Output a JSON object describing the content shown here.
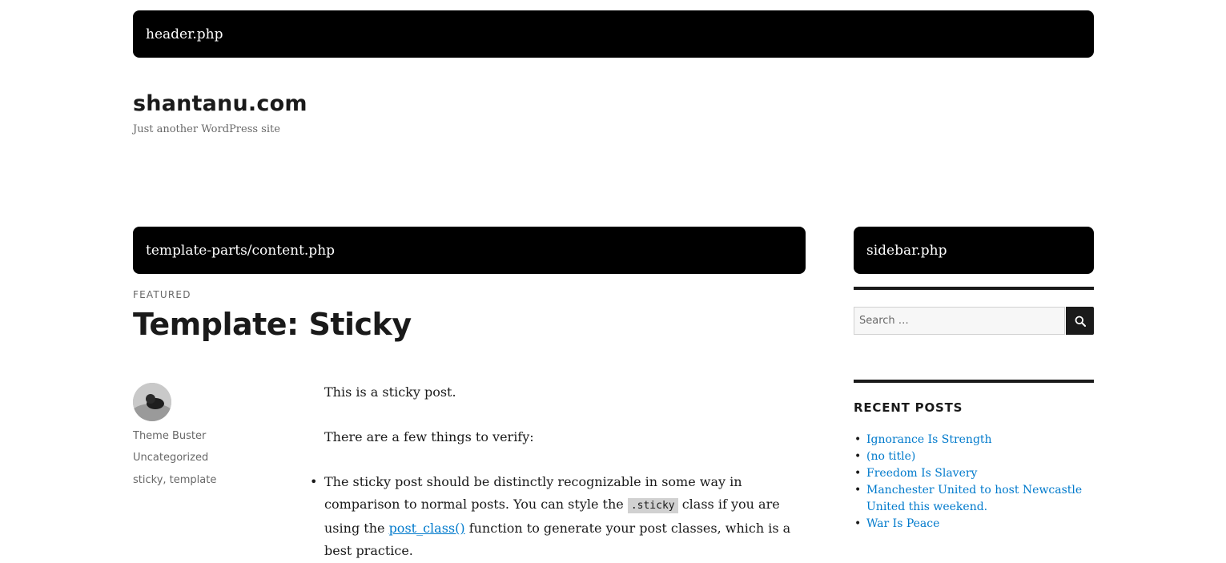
{
  "labels": {
    "header": "header.php",
    "content": "template-parts/content.php",
    "sidebar": "sidebar.php"
  },
  "site": {
    "title": "shantanu.com",
    "description": "Just another WordPress site"
  },
  "post": {
    "featured": "FEATURED",
    "title": "Template: Sticky",
    "author": "Theme Buster",
    "category": "Uncategorized",
    "tags": "sticky, template",
    "p1": "This is a sticky post.",
    "p2": "There are a few things to verify:",
    "li1_a": "The sticky post should be distinctly recognizable in some way in comparison to normal posts. You can style the ",
    "li1_code": ".sticky",
    "li1_b": " class if you are using the ",
    "li1_link": "post_class()",
    "li1_c": " function to generate your post classes, which is a best practice."
  },
  "search": {
    "placeholder": "Search …",
    "icon": "search-icon"
  },
  "recent": {
    "title": "RECENT POSTS",
    "items": [
      "Ignorance Is Strength",
      "(no title)",
      "Freedom Is Slavery",
      "Manchester United to host Newcastle United this weekend.",
      "War Is Peace"
    ]
  },
  "colors": {
    "link": "#007acc",
    "text": "#1a1a1a",
    "muted": "#686868",
    "label_bg": "#000000"
  }
}
